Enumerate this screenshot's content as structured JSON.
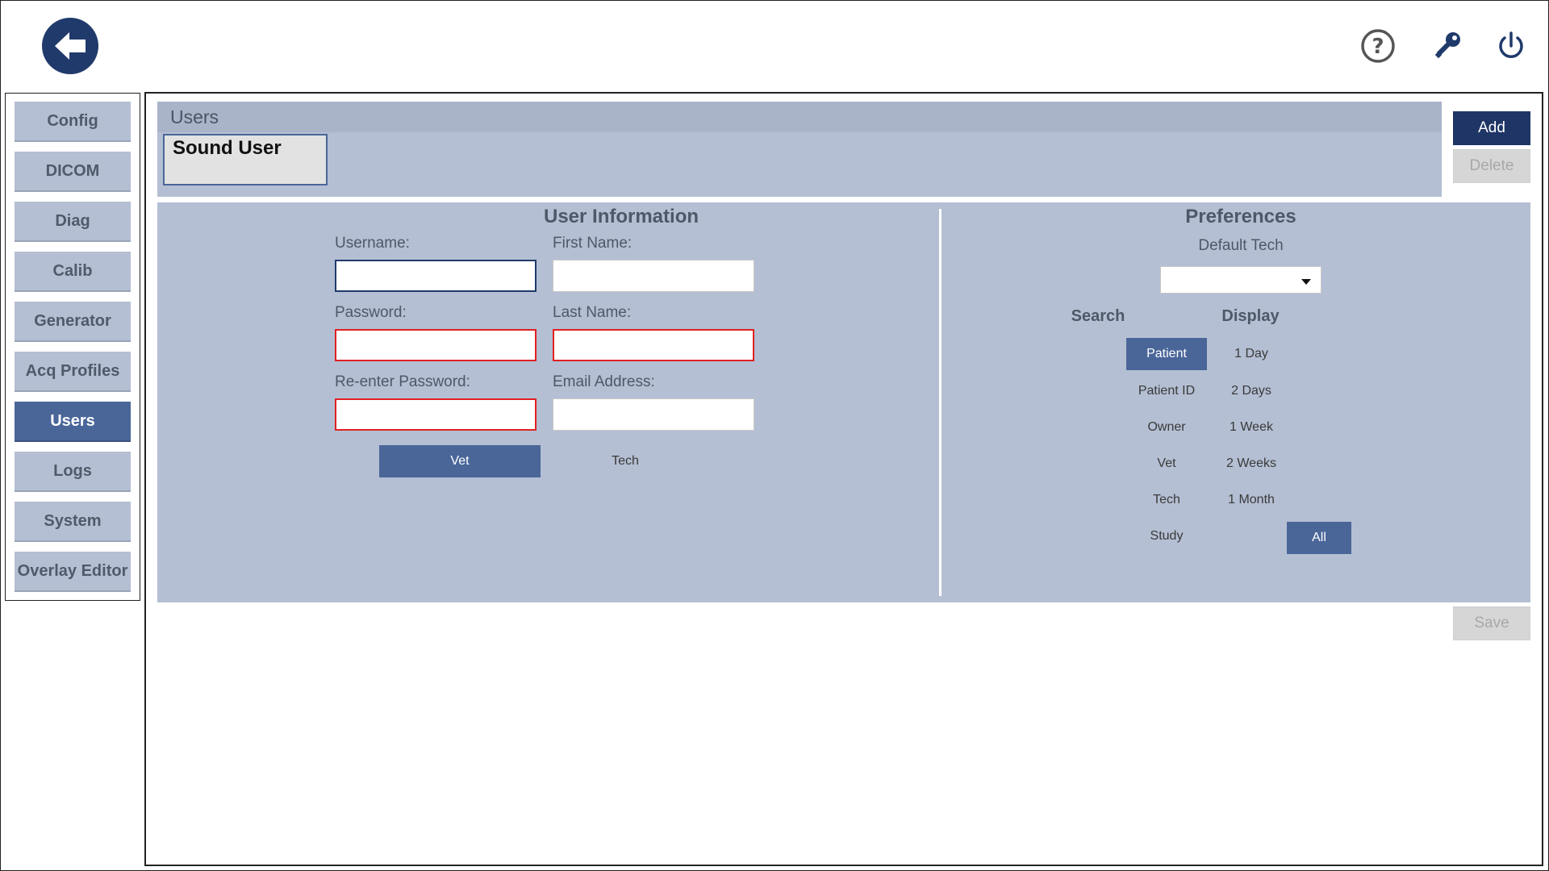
{
  "header": {
    "back_icon": "back-arrow-icon",
    "help_icon": "help-circle-icon",
    "key_icon": "key-icon",
    "power_icon": "power-icon"
  },
  "sidebar": {
    "items": [
      {
        "label": "Config"
      },
      {
        "label": "DICOM"
      },
      {
        "label": "Diag"
      },
      {
        "label": "Calib"
      },
      {
        "label": "Generator"
      },
      {
        "label": "Acq Profiles"
      },
      {
        "label": "Users",
        "active": true
      },
      {
        "label": "Logs"
      },
      {
        "label": "System"
      },
      {
        "label": "Overlay Editor"
      }
    ]
  },
  "users": {
    "title": "Users",
    "list": [
      {
        "name": "Sound User"
      }
    ],
    "add_label": "Add",
    "delete_label": "Delete"
  },
  "user_info": {
    "title": "User Information",
    "username_label": "Username:",
    "username_value": "",
    "first_name_label": "First Name:",
    "first_name_value": "",
    "password_label": "Password:",
    "password_value": "",
    "last_name_label": "Last Name:",
    "last_name_value": "",
    "reenter_label": "Re-enter Password:",
    "reenter_value": "",
    "email_label": "Email Address:",
    "email_value": "",
    "role_vet": "Vet",
    "role_tech": "Tech",
    "selected_role": "Vet"
  },
  "preferences": {
    "title": "Preferences",
    "default_tech_label": "Default Tech",
    "default_tech_value": "",
    "search_header": "Search",
    "display_header": "Display",
    "search_options": [
      "Patient",
      "Patient ID",
      "Owner",
      "Vet",
      "Tech",
      "Study"
    ],
    "search_selected": "Patient",
    "display_options": [
      "1 Day",
      "2 Days",
      "1 Week",
      "2 Weeks",
      "1 Month",
      "All"
    ],
    "display_selected": "All"
  },
  "footer": {
    "save_label": "Save"
  },
  "colors": {
    "accent_dark": "#1e3565",
    "accent": "#4a6699",
    "panel": "#b4bfd3",
    "error": "#e02020"
  }
}
